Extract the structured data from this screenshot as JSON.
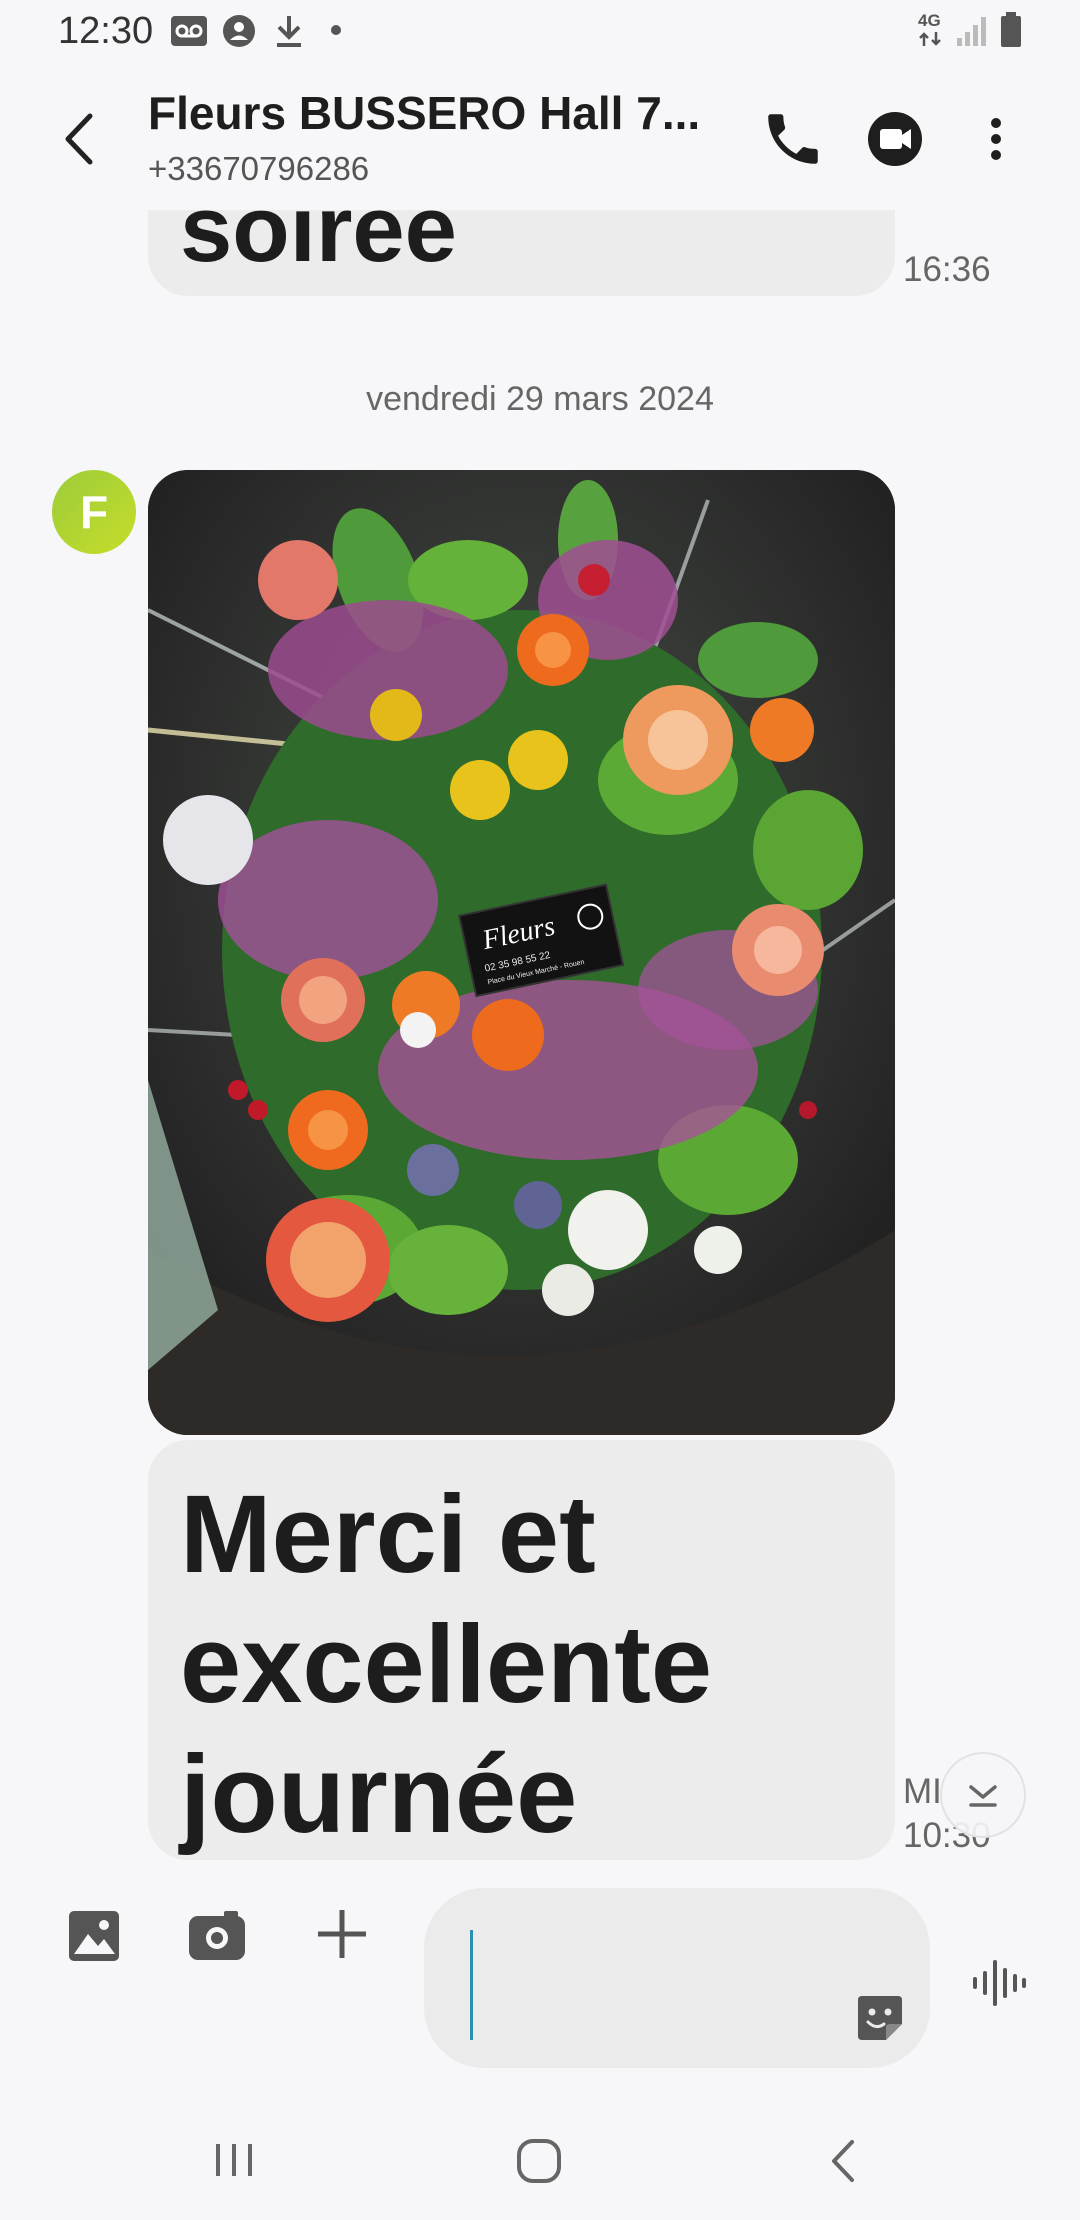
{
  "status_bar": {
    "time": "12:30",
    "network": "4G",
    "icons": [
      "voicemail-icon",
      "account-icon",
      "download-icon",
      "dot-icon",
      "network-4g-icon",
      "signal-icon",
      "battery-icon"
    ]
  },
  "header": {
    "contact_name": "Fleurs BUSSERO Hall 7...",
    "phone_number": "+33670796286",
    "actions": [
      "back-icon",
      "phone-icon",
      "video-call-icon",
      "more-vert-icon"
    ]
  },
  "conversation": {
    "previous_message": {
      "text": "soirée",
      "time": "16:36"
    },
    "date_separator": "vendredi 29 mars 2024",
    "sender_avatar_letter": "F",
    "image_message": {
      "card_brand": "Fleurs",
      "card_phone": "02 35 98 55 22",
      "card_address": "Place du Vieux Marché - Rouen"
    },
    "text_message": {
      "text": "Merci et excellente journée",
      "meta_line1": "MI",
      "time": "10:30"
    }
  },
  "composer": {
    "placeholder": "",
    "buttons": [
      "gallery-icon",
      "camera-icon",
      "add-icon",
      "sticker-icon",
      "voice-input-icon"
    ]
  },
  "colors": {
    "background": "#f7f7f9",
    "bubble": "#ececed",
    "avatar": "#a8d02c",
    "caret": "#2a8fb0"
  }
}
